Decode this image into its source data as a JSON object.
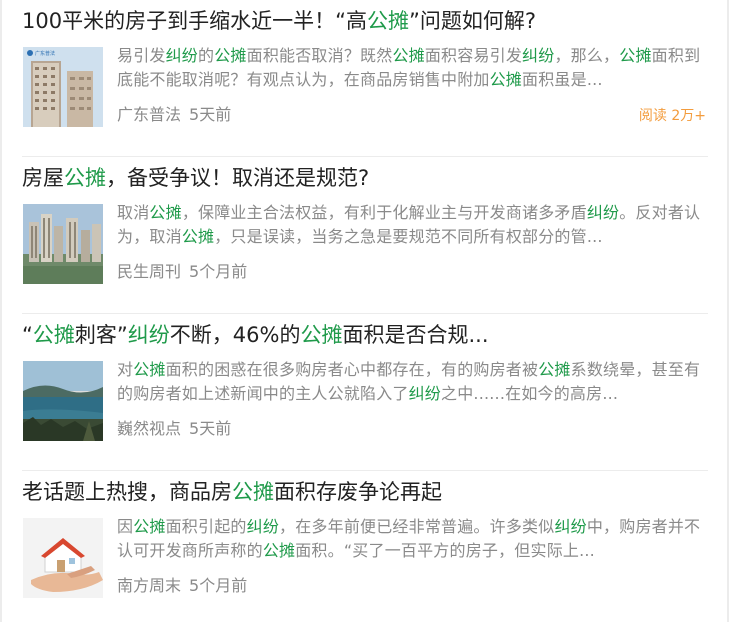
{
  "colors": {
    "highlight": "#1f9a4a",
    "read_count": "#f39c3d",
    "meta": "#8a8a8a",
    "title": "#222222"
  },
  "articles": [
    {
      "title_parts": [
        {
          "text": "100平米的房子到手缩水近一半！“高",
          "hl": false
        },
        {
          "text": "公摊",
          "hl": true
        },
        {
          "text": "”问题如何解?",
          "hl": false
        }
      ],
      "summary_parts": [
        {
          "text": "易引发",
          "hl": false
        },
        {
          "text": "纠纷",
          "hl": true
        },
        {
          "text": "的",
          "hl": false
        },
        {
          "text": "公摊",
          "hl": true
        },
        {
          "text": "面积能否取消？既然",
          "hl": false
        },
        {
          "text": "公摊",
          "hl": true
        },
        {
          "text": "面积容易引发",
          "hl": false
        },
        {
          "text": "纠纷",
          "hl": true
        },
        {
          "text": "，那么，",
          "hl": false
        },
        {
          "text": "公摊",
          "hl": true
        },
        {
          "text": "面积到底能不能取消呢？有观点认为，在商品房销售中附加",
          "hl": false
        },
        {
          "text": "公摊",
          "hl": true
        },
        {
          "text": "面积虽是...",
          "hl": false
        }
      ],
      "source": "广东普法",
      "time": "5天前",
      "reads": "阅读 2万+",
      "thumb_icon": "buildings-thumbnail",
      "thumb_overlay_text": "广东普法"
    },
    {
      "title_parts": [
        {
          "text": "房屋",
          "hl": false
        },
        {
          "text": "公摊",
          "hl": true
        },
        {
          "text": "，备受争议！取消还是规范?",
          "hl": false
        }
      ],
      "summary_parts": [
        {
          "text": "取消",
          "hl": false
        },
        {
          "text": "公摊",
          "hl": true
        },
        {
          "text": "，保障业主合法权益，有利于化解业主与开发商诸多矛盾",
          "hl": false
        },
        {
          "text": "纠纷",
          "hl": true
        },
        {
          "text": "。反对者认为，取消",
          "hl": false
        },
        {
          "text": "公摊",
          "hl": true
        },
        {
          "text": "，只是误读，当务之急是要规范不同所有权部分的管...",
          "hl": false
        }
      ],
      "source": "民生周刊",
      "time": "5个月前",
      "reads": "",
      "thumb_icon": "skyline-thumbnail"
    },
    {
      "title_parts": [
        {
          "text": "“",
          "hl": false
        },
        {
          "text": "公摊",
          "hl": true
        },
        {
          "text": "刺客”",
          "hl": false
        },
        {
          "text": "纠纷",
          "hl": true
        },
        {
          "text": "不断，46%的",
          "hl": false
        },
        {
          "text": "公摊",
          "hl": true
        },
        {
          "text": "面积是否合规...",
          "hl": false
        }
      ],
      "summary_parts": [
        {
          "text": "对",
          "hl": false
        },
        {
          "text": "公摊",
          "hl": true
        },
        {
          "text": "面积的困惑在很多购房者心中都存在，有的购房者被",
          "hl": false
        },
        {
          "text": "公摊",
          "hl": true
        },
        {
          "text": "系数绕晕，甚至有的购房者如上述新闻中的主人公就陷入了",
          "hl": false
        },
        {
          "text": "纠纷",
          "hl": true
        },
        {
          "text": "之中......在如今的高房...",
          "hl": false
        }
      ],
      "source": "巍然视点",
      "time": "5天前",
      "reads": "",
      "thumb_icon": "lake-thumbnail"
    },
    {
      "title_parts": [
        {
          "text": "老话题上热搜，商品房",
          "hl": false
        },
        {
          "text": "公摊",
          "hl": true
        },
        {
          "text": "面积存废争论再起",
          "hl": false
        }
      ],
      "summary_parts": [
        {
          "text": "因",
          "hl": false
        },
        {
          "text": "公摊",
          "hl": true
        },
        {
          "text": "面积引起的",
          "hl": false
        },
        {
          "text": "纠纷",
          "hl": true
        },
        {
          "text": "，在多年前便已经非常普遍。许多类似",
          "hl": false
        },
        {
          "text": "纠纷",
          "hl": true
        },
        {
          "text": "中，购房者并不认可开发商所声称的",
          "hl": false
        },
        {
          "text": "公摊",
          "hl": true
        },
        {
          "text": "面积。“买了一百平方的房子，但实际上...",
          "hl": false
        }
      ],
      "source": "南方周末",
      "time": "5个月前",
      "reads": "",
      "thumb_icon": "house-in-hand-thumbnail"
    }
  ]
}
